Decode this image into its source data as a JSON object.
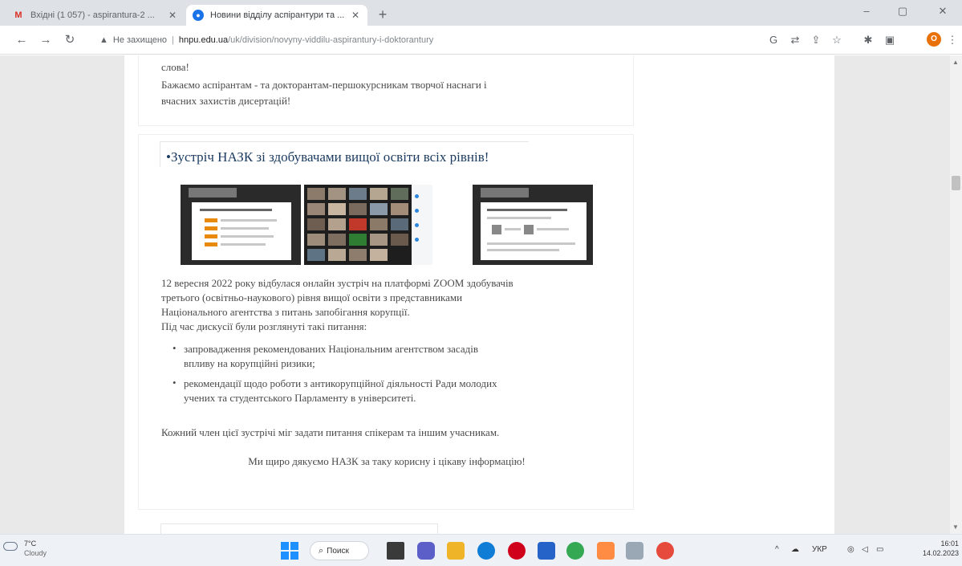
{
  "browser": {
    "tabs": [
      {
        "title": "Вхідні (1 057) - aspirantura-2 ...",
        "favicon": "gmail-icon"
      },
      {
        "title": "Новини відділу аспірантури та ...",
        "favicon": "globe-icon"
      }
    ],
    "new_tab_label": "+",
    "window_controls": [
      "–",
      "▢",
      "✕"
    ],
    "address": {
      "security_label": "Не захищено",
      "domain": "hnpu.edu.ua",
      "path": "/uk/division/novyny-viddilu-aspirantury-i-doktorantury"
    },
    "profile_initial": "O"
  },
  "page": {
    "prev_post": {
      "line1": "слова!",
      "line2": "Бажаємо аспірантам - та докторантам-першокурсникам творчої наснаги і",
      "line3": "вчасних захистів дисертацій!"
    },
    "post": {
      "heading": "•Зустріч НАЗК зі здобувачами вищої освіти всіх рівнів!",
      "intro_line1": "12 вересня 2022 року відбулася онлайн зустріч на платформі ZOOM здобувачів",
      "intro_line2": "третього (освітньо-наукового) рівня вищої освіти з представниками",
      "intro_line3": "Національного агентства з питань запобігання корупції.",
      "intro_line4": "Під час дискусії були розглянуті такі питання:",
      "bullet1_line1": "запровадження рекомендованих Національним агентством засадів",
      "bullet1_line2": "впливу на корупційні ризики;",
      "bullet2_line1": "рекомендації щодо роботи з антикорупційної діяльності Ради молодих",
      "bullet2_line2": "учених та студентського Парламенту в університеті.",
      "closing": "Кожний член цієї зустрічі міг задати питання спікерам та іншим учасникам.",
      "thanks": "Ми щиро дякуємо НАЗК за таку корисну і цікаву інформацію!"
    }
  },
  "taskbar": {
    "weather": {
      "temp": "7°C",
      "condition": "Cloudy"
    },
    "search_label": "Поиск",
    "lang": "УКР",
    "time": "16:01",
    "date": "14.02.2023"
  },
  "colors": {
    "heading": "#1c3c62",
    "gutter": "#e9e9e9",
    "accent_orange": "#e8890c"
  }
}
